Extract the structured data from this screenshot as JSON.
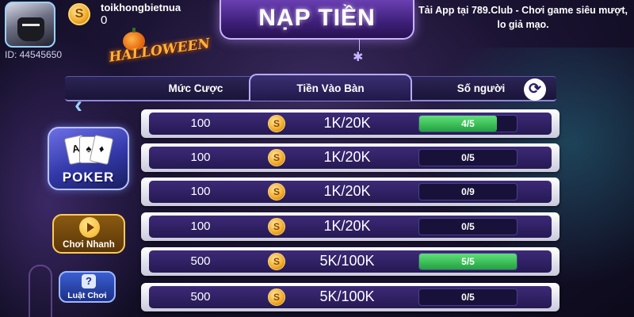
{
  "user": {
    "name": "toikhongbietnua",
    "balance": "0",
    "id_text": "ID: 44545650"
  },
  "title": "NẠP TIỀN",
  "announcement": {
    "line1": "Tải App tại 789.Club - Chơi game siêu mượt,",
    "line2": "lo giả mạo."
  },
  "event_badge": "HALLOWEEN",
  "table_header": {
    "bet": "Mức Cược",
    "money": "Tiền Vào Bàn",
    "players": "Số người"
  },
  "sidebar": {
    "game_label": "POKER",
    "quick_play": "Chơi Nhanh",
    "rules": "Luật Chơi"
  },
  "icons": {
    "coin": "S",
    "back": "‹",
    "refresh": "⟳",
    "rules": "?"
  },
  "rows": [
    {
      "bet": "100",
      "money": "1K/20K",
      "players": "4/5",
      "fill": 0.8
    },
    {
      "bet": "100",
      "money": "1K/20K",
      "players": "0/5",
      "fill": 0
    },
    {
      "bet": "100",
      "money": "1K/20K",
      "players": "0/9",
      "fill": 0
    },
    {
      "bet": "100",
      "money": "1K/20K",
      "players": "0/5",
      "fill": 0
    },
    {
      "bet": "500",
      "money": "5K/100K",
      "players": "5/5",
      "fill": 1
    },
    {
      "bet": "500",
      "money": "5K/100K",
      "players": "0/5",
      "fill": 0
    }
  ],
  "colors": {
    "accent": "#b7acff",
    "full_bar": "#22a23f"
  }
}
